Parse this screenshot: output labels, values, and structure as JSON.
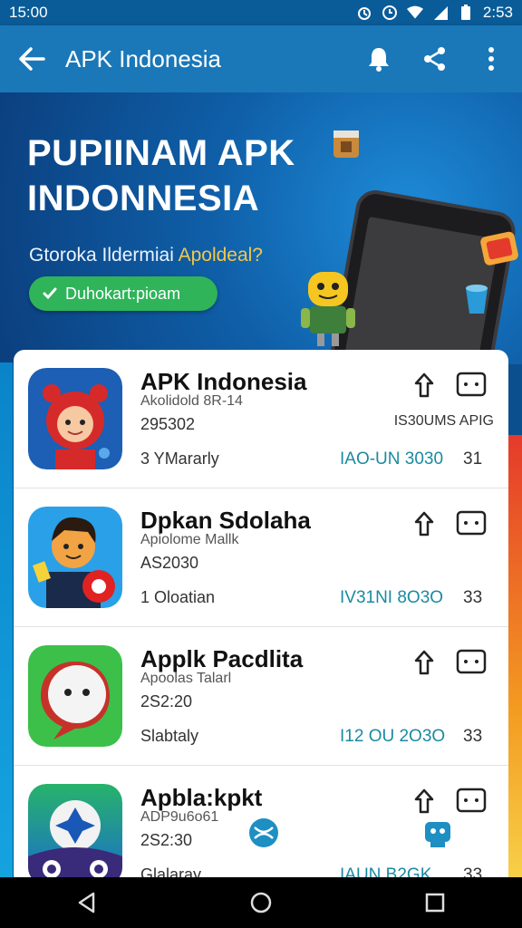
{
  "status": {
    "left_time": "15:00",
    "right_time": "2:53"
  },
  "appbar": {
    "title": "APK Indonesia"
  },
  "hero": {
    "title_line1": "PUPIINAM APK",
    "title_line2": "INDONNESIA",
    "subtitle_a": "Gtoroka Ildermiai ",
    "subtitle_b": "Apoldeal?",
    "button_label": "Duhokart:pioam"
  },
  "apps": [
    {
      "name": "APK Indonesia",
      "pkg": "Akolidold 8R-14",
      "ver": "295302",
      "meta": "3 YMararly",
      "date": "IAO-UN 3030",
      "count": "31",
      "tag": "IS30UMS APIG"
    },
    {
      "name": "Dpkan Sdolaha",
      "pkg": "Apiolome Mallk",
      "ver": "AS2030",
      "meta": "1 Oloatian",
      "date": "IV31NI 8O3O",
      "count": "33",
      "tag": ""
    },
    {
      "name": "Applk Pacdlita",
      "pkg": "Apoolas Talarl",
      "ver": "2S2:20",
      "meta": "Slabtaly",
      "date": "I12 OU 2O3O",
      "count": "33",
      "tag": ""
    },
    {
      "name": "Apbla:kpkt",
      "pkg": "ADP9u6o61",
      "ver": "2S2:30",
      "meta": "Glalaray",
      "date": "IAUN B2GK",
      "count": "33",
      "tag": ""
    }
  ],
  "icons": {
    "back": "arrow-left-icon",
    "bell": "bell-icon",
    "share": "share-icon",
    "more": "more-vert-icon",
    "upload": "upload-icon",
    "download": "download-icon"
  },
  "colors": {
    "appbar": "#1a78b8",
    "accent_green": "#2fb45a",
    "date_teal": "#1b8aa0"
  }
}
